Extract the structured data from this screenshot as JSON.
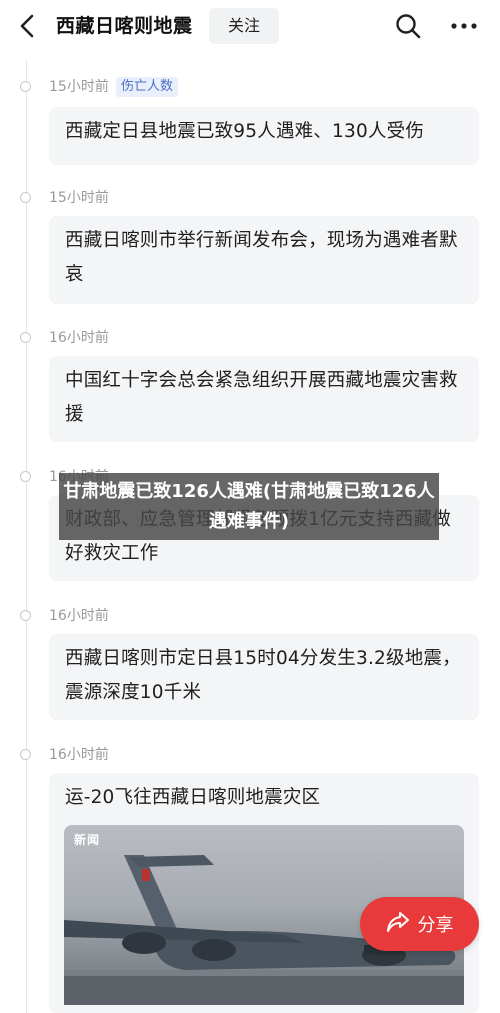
{
  "header": {
    "title": "西藏日喀则地震",
    "follow_label": "关注"
  },
  "timeline": [
    {
      "time": "15小时前",
      "tag": "伤亡人数",
      "text": "西藏定日县地震已致95人遇难、130人受伤"
    },
    {
      "time": "15小时前",
      "text": "西藏日喀则市举行新闻发布会，现场为遇难者默哀"
    },
    {
      "time": "16小时前",
      "text": "中国红十字会总会紧急组织开展西藏地震灾害救援"
    },
    {
      "time": "16小时前",
      "text": "财政部、应急管理部紧急预拨1亿元支持西藏做好救灾工作"
    },
    {
      "time": "16小时前",
      "text": "西藏日喀则市定日县15时04分发生3.2级地震，震源深度10千米"
    },
    {
      "time": "16小时前",
      "text": "运-20飞往西藏日喀则地震灾区",
      "image_badge": "新闻"
    }
  ],
  "overlay": {
    "caption": "甘肃地震已致126人遇难(甘肃地震已致126人遇难事件)"
  },
  "share": {
    "label": "分享"
  },
  "colors": {
    "accent_red": "#e83a3a",
    "tag_blue": "#4b6fc8",
    "card_bg": "#f4f5f7"
  }
}
